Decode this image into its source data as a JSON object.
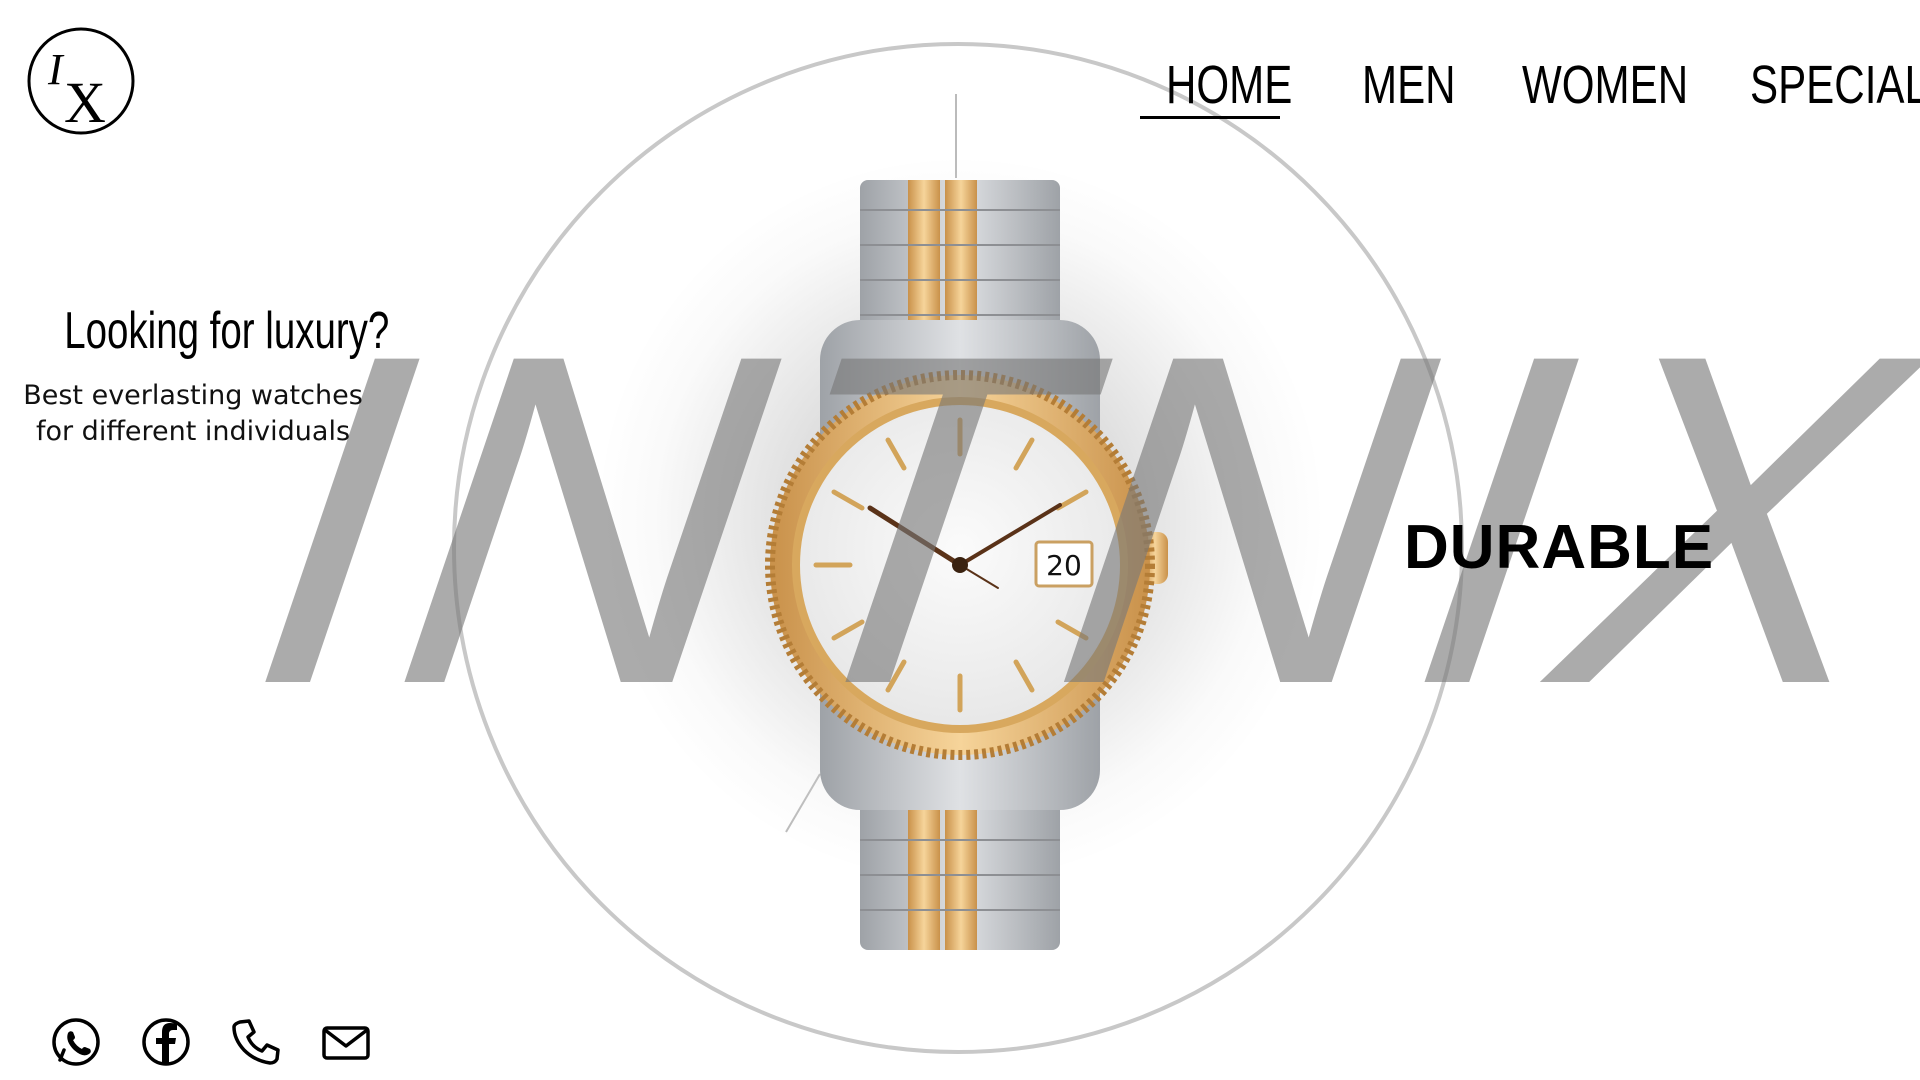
{
  "logo": {
    "glyph_top": "I",
    "glyph_main": "X"
  },
  "nav": {
    "items": [
      {
        "label": "HOME",
        "active": true
      },
      {
        "label": "MEN",
        "active": false
      },
      {
        "label": "WOMEN",
        "active": false
      },
      {
        "label": "SPECIAL",
        "active": false
      }
    ]
  },
  "hero": {
    "headline": "Looking for luxury?",
    "subline_1": "Best everlasting watches",
    "subline_2": "for different individuals",
    "brand": "INTNIX",
    "tagline": "DURABLE",
    "watch_date": "20"
  },
  "social": {
    "icons": [
      "whatsapp-icon",
      "facebook-icon",
      "phone-icon",
      "mail-icon"
    ]
  },
  "colors": {
    "gold": "#E0B268",
    "steel": "#B9BCC0",
    "brand_text": "#8C8C8C"
  }
}
